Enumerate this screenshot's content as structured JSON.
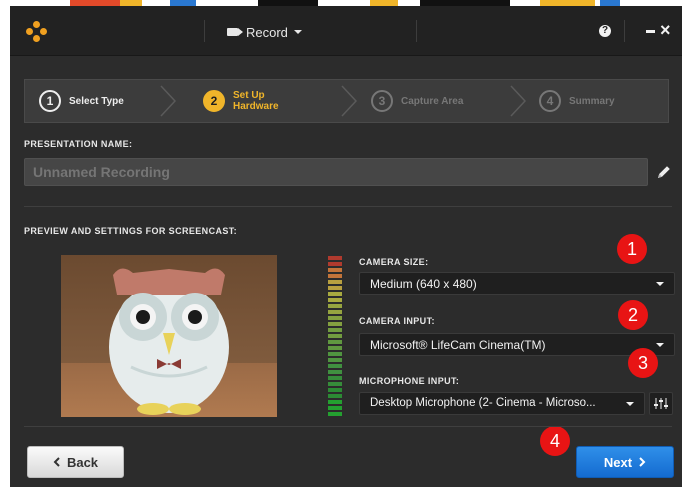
{
  "window": {
    "record_label": "Record",
    "help_icon": "question-circle-icon",
    "minimize_icon": "minimize-icon",
    "close_icon": "close-icon"
  },
  "steps": [
    {
      "number": "1",
      "label": "Select Type",
      "state": "done"
    },
    {
      "number": "2",
      "label": "Set Up Hardware",
      "state": "active"
    },
    {
      "number": "3",
      "label": "Capture Area",
      "state": "future"
    },
    {
      "number": "4",
      "label": "Summary",
      "state": "future"
    }
  ],
  "presentation": {
    "section_label": "PRESENTATION NAME:",
    "name_placeholder": "Unnamed Recording",
    "name_value": ""
  },
  "preview": {
    "section_label": "PREVIEW AND SETTINGS FOR SCREENCAST:"
  },
  "settings": {
    "camera_size_label": "CAMERA SIZE:",
    "camera_size_value": "Medium (640 x 480)",
    "camera_input_label": "CAMERA INPUT:",
    "camera_input_value": "Microsoft® LifeCam Cinema(TM)",
    "microphone_input_label": "MICROPHONE INPUT:",
    "microphone_input_value": "Desktop Microphone (2- Cinema - Microso..."
  },
  "annotations": [
    "1",
    "2",
    "3",
    "4"
  ],
  "buttons": {
    "back_label": "Back",
    "next_label": "Next"
  },
  "colors": {
    "accent": "#f0b52a",
    "primary_button": "#1f7fe0",
    "annotation_badge": "#e81414"
  }
}
